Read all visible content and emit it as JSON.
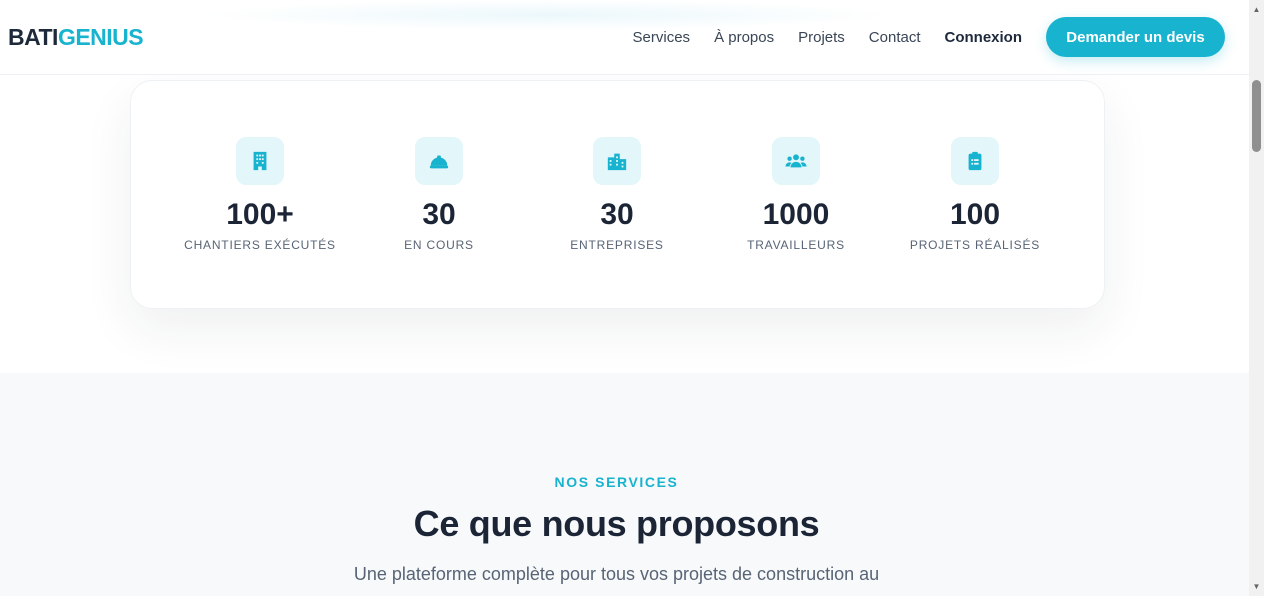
{
  "header": {
    "logo": {
      "part1": "BATI",
      "part2": "GENIUS"
    },
    "nav": [
      "Services",
      "À propos",
      "Projets",
      "Contact"
    ],
    "login_label": "Connexion",
    "cta_label": "Demander un devis"
  },
  "stats": [
    {
      "icon": "building-icon",
      "value": "100+",
      "label": "CHANTIERS EXÉCUTÉS"
    },
    {
      "icon": "hard-hat-icon",
      "value": "30",
      "label": "EN COURS"
    },
    {
      "icon": "city-icon",
      "value": "30",
      "label": "ENTREPRISES"
    },
    {
      "icon": "users-icon",
      "value": "1000",
      "label": "TRAVAILLEURS"
    },
    {
      "icon": "clipboard-list-icon",
      "value": "100",
      "label": "PROJETS RÉALISÉS"
    }
  ],
  "services": {
    "eyebrow": "NOS SERVICES",
    "title": "Ce que nous proposons",
    "description": "Une plateforme complète pour tous vos projets de construction au"
  },
  "colors": {
    "accent": "#17b3cf",
    "dark": "#1e2a3b",
    "icon_bg": "#e3f6fa",
    "section_bg": "#f7f9fb"
  }
}
